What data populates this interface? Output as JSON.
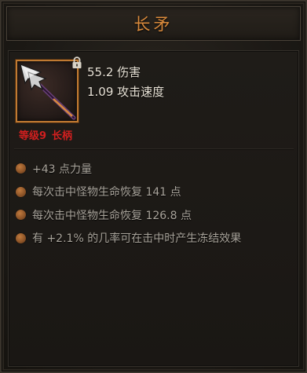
{
  "item": {
    "name": "长矛",
    "stats": [
      "55.2 伤害",
      "1.09 攻击速度"
    ],
    "level_label": "等级9",
    "type_label": "长柄",
    "icon": "spear-icon",
    "lock_icon": "lock-icon"
  },
  "affixes": [
    "+43 点力量",
    "每次击中怪物生命恢复 141 点",
    "每次击中怪物生命恢复 126.8 点",
    "有 +2.1% 的几率可在击中时产生冻结效果"
  ],
  "colors": {
    "title": "#d98a3c",
    "level_red": "#d21f1f",
    "icon_border": "#c07a32",
    "affix_text": "#a8a39a",
    "bullet": "#8a5226"
  }
}
